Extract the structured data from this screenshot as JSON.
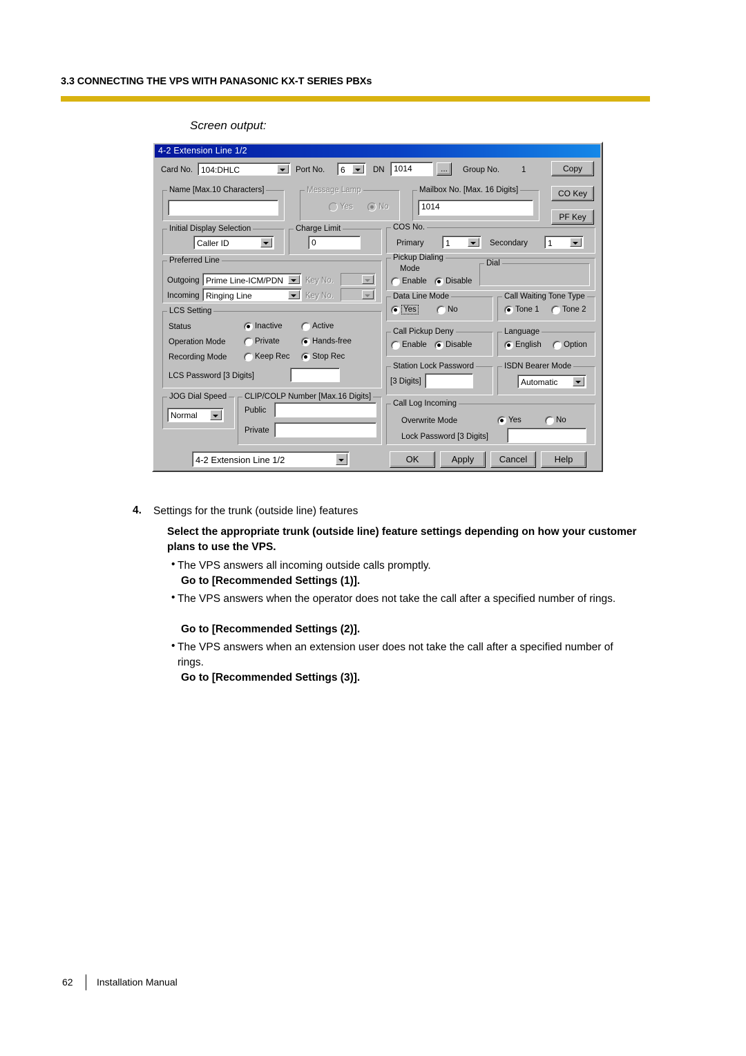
{
  "header": {
    "section_title": "3.3 CONNECTING THE VPS WITH PANASONIC KX-T SERIES PBXs",
    "rule_color": "#d9b310",
    "screen_output_label": "Screen output:"
  },
  "dialog": {
    "title": "4-2 Extension Line 1/2",
    "titlebar_color_start": "#05169c",
    "titlebar_color_end": "#1588e8",
    "face_color": "#c0c0c0",
    "top_row": {
      "card_no_label": "Card No.",
      "card_no_value": "104:DHLC",
      "port_no_label": "Port No.",
      "port_no_value": "6",
      "dn_label": "DN",
      "dn_value": "1014",
      "dn_browse_label": "...",
      "group_no_label": "Group No.",
      "group_no_value": "1"
    },
    "side_buttons": {
      "copy": "Copy",
      "co_key": "CO Key",
      "pf_key": "PF Key"
    },
    "name_group": {
      "legend": "Name [Max.10 Characters]",
      "value": ""
    },
    "message_lamp": {
      "legend": "Message Lamp",
      "disabled": true,
      "yes": "Yes",
      "no": "No",
      "selected": "No"
    },
    "mailbox": {
      "legend": "Mailbox No. [Max. 16 Digits]",
      "value": "1014"
    },
    "initial_display": {
      "legend": "Initial Display Selection",
      "value": "Caller ID"
    },
    "charge_limit": {
      "legend": "Charge Limit",
      "value": "0"
    },
    "cos_no": {
      "legend": "COS No.",
      "primary_label": "Primary",
      "primary_value": "1",
      "secondary_label": "Secondary",
      "secondary_value": "1"
    },
    "preferred_line": {
      "legend": "Preferred Line",
      "outgoing_label": "Outgoing",
      "outgoing_value": "Prime Line-ICM/PDN",
      "outgoing_key_label": "Key No.",
      "outgoing_key_value": "",
      "incoming_label": "Incoming",
      "incoming_value": "Ringing Line",
      "incoming_key_label": "Key No.",
      "incoming_key_value": ""
    },
    "pickup_dialing": {
      "legend": "Pickup Dialing",
      "mode_label": "Mode",
      "enable": "Enable",
      "disable": "Disable",
      "selected": "Disable",
      "dial_legend": "Dial",
      "dial_value": ""
    },
    "lcs_setting": {
      "legend": "LCS Setting",
      "status_label": "Status",
      "status_opt1": "Inactive",
      "status_opt2": "Active",
      "status_selected": "Inactive",
      "operation_label": "Operation Mode",
      "operation_opt1": "Private",
      "operation_opt2": "Hands-free",
      "operation_selected": "Hands-free",
      "recording_label": "Recording Mode",
      "recording_opt1": "Keep Rec",
      "recording_opt2": "Stop Rec",
      "recording_selected": "Stop Rec",
      "password_label": "LCS Password [3 Digits]",
      "password_value": ""
    },
    "data_line_mode": {
      "legend": "Data Line Mode",
      "yes": "Yes",
      "no": "No",
      "selected": "Yes",
      "focused": "Yes"
    },
    "call_waiting_tone": {
      "legend": "Call Waiting Tone Type",
      "opt1": "Tone 1",
      "opt2": "Tone 2",
      "selected": "Tone 1"
    },
    "call_pickup_deny": {
      "legend": "Call Pickup Deny",
      "enable": "Enable",
      "disable": "Disable",
      "selected": "Disable"
    },
    "language": {
      "legend": "Language",
      "opt1": "English",
      "opt2": "Option",
      "selected": "English"
    },
    "station_lock_password": {
      "legend": "Station Lock Password",
      "digits_label": "[3 Digits]",
      "value": ""
    },
    "isdn_bearer_mode": {
      "legend": "ISDN Bearer Mode",
      "value": "Automatic"
    },
    "call_log_incoming": {
      "legend": "Call Log Incoming",
      "overwrite_label": "Overwrite Mode",
      "overwrite_yes": "Yes",
      "overwrite_no": "No",
      "overwrite_selected": "Yes",
      "lock_password_label": "Lock Password [3 Digits]",
      "lock_password_value": ""
    },
    "jog_dial_speed": {
      "legend": "JOG Dial Speed",
      "value": "Normal"
    },
    "clip_colp": {
      "legend": "CLIP/COLP Number [Max.16 Digits]",
      "public_label": "Public",
      "public_value": "",
      "private_label": "Private",
      "private_value": ""
    },
    "page_selector_value": "4-2 Extension Line 1/2",
    "buttons": {
      "ok": "OK",
      "apply": "Apply",
      "cancel": "Cancel",
      "help": "Help"
    }
  },
  "body": {
    "step_number": "4.",
    "step_title": "Settings for the trunk (outside line) features",
    "bold_paragraph": "Select the appropriate trunk (outside line) feature settings depending on how your customer plans to use the VPS.",
    "bullets": [
      {
        "bullet": "•",
        "text": "The VPS answers all incoming outside calls promptly.",
        "action": "Go to [Recommended Settings (1)]."
      },
      {
        "bullet": "•",
        "text": "The VPS answers when the operator does not take the call after a specified number of rings.",
        "action": "Go to [Recommended Settings (2)]."
      },
      {
        "bullet": "•",
        "text": "The VPS answers when an extension user does not take the call after a specified number of rings.",
        "action": "Go to [Recommended Settings (3)]."
      }
    ]
  },
  "footer": {
    "page_number": "62",
    "doc_title": "Installation Manual"
  }
}
